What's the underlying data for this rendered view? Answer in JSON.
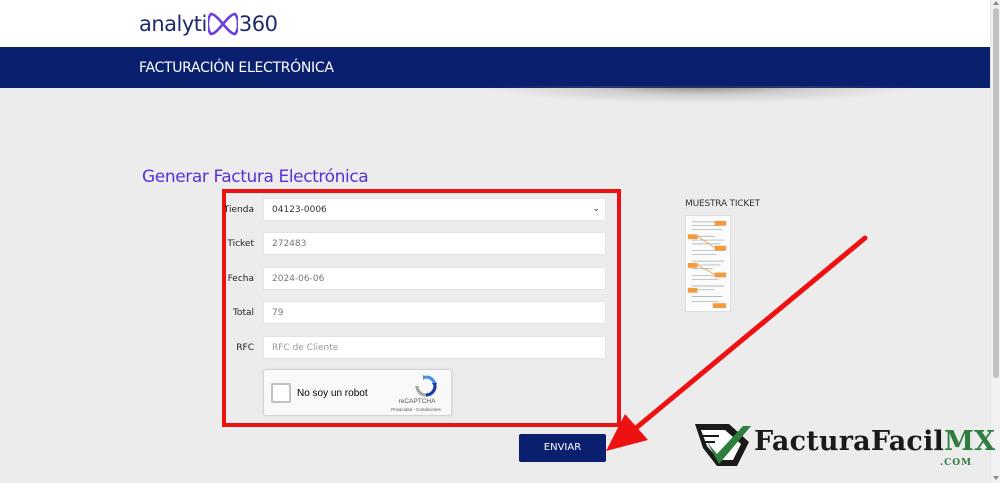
{
  "header": {
    "logo_left": "analyti",
    "logo_right": "360",
    "nav_title": "FACTURACIÓN ELECTRÓNICA"
  },
  "page": {
    "heading": "Generar Factura Electrónica"
  },
  "form": {
    "store": {
      "label": "Tienda",
      "value": "04123-0006"
    },
    "ticket": {
      "label": "Ticket",
      "value": "272483"
    },
    "date": {
      "label": "Fecha",
      "value": "2024-06-06"
    },
    "total": {
      "label": "Total",
      "value": "79"
    },
    "rfc": {
      "label": "RFC",
      "placeholder": "RFC de Cliente"
    },
    "recaptcha": {
      "label": "No soy un robot",
      "brand": "reCAPTCHA",
      "links": "Privacidad - Condiciones"
    },
    "submit_label": "ENVIAR"
  },
  "sample": {
    "title": "MUESTRA TICKET"
  },
  "watermark": {
    "brand_main": "FacturaFacil",
    "brand_mx": "MX",
    "brand_sub": ".COM"
  },
  "colors": {
    "navy": "#0b1f6f",
    "heading_purple": "#5b2fd6",
    "highlight_red": "#ee1111",
    "watermark_green": "#2f7d3f"
  },
  "icons": {
    "select_chevron": "chevron-down-icon",
    "recaptcha_logo": "recaptcha-icon",
    "annotation_arrow": "arrow-icon"
  }
}
